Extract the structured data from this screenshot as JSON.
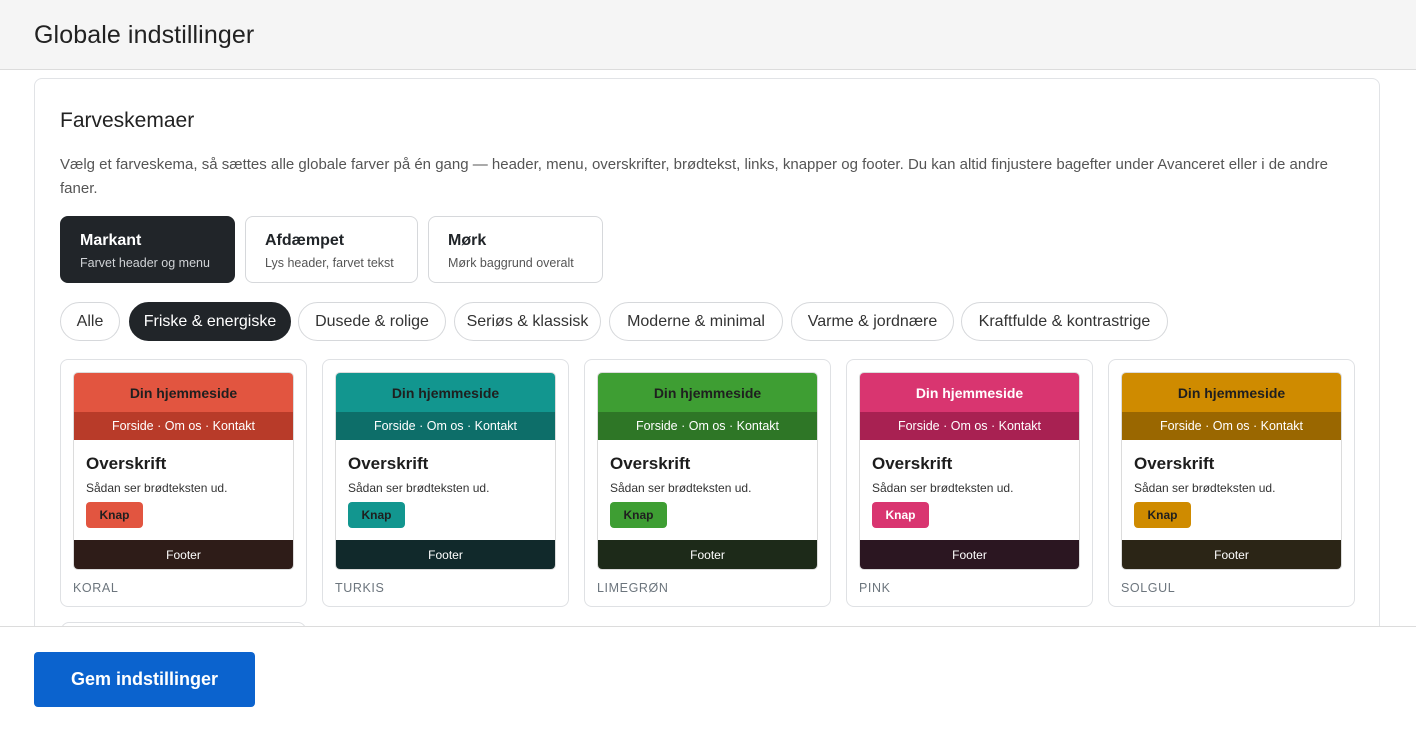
{
  "header": {
    "title": "Globale indstillinger"
  },
  "section": {
    "title": "Farveskemaer",
    "description": "Vælg et farveskema, så sættes alle globale farver på én gang — header, menu, overskrifter, brødtekst, links, knapper og footer. Du kan altid finjustere bagefter under Avanceret eller i de andre faner."
  },
  "modes": [
    {
      "title": "Markant",
      "subtitle": "Farvet header og menu",
      "active": true
    },
    {
      "title": "Afdæmpet",
      "subtitle": "Lys header, farvet tekst",
      "active": false
    },
    {
      "title": "Mørk",
      "subtitle": "Mørk baggrund overalt",
      "active": false
    }
  ],
  "filters": [
    {
      "label": "Alle",
      "active": false
    },
    {
      "label": "Friske & energiske",
      "active": true
    },
    {
      "label": "Dusede & rolige",
      "active": false
    },
    {
      "label": "Seriøs & klassisk",
      "active": false
    },
    {
      "label": "Moderne & minimal",
      "active": false
    },
    {
      "label": "Varme & jordnære",
      "active": false
    },
    {
      "label": "Kraftfulde & kontrastrige",
      "active": false
    }
  ],
  "preview": {
    "site_title": "Din hjemmeside",
    "nav": "Forside · Om os · Kontakt",
    "heading": "Overskrift",
    "body_text": "Sådan ser brødteksten ud.",
    "button": "Knap",
    "footer": "Footer"
  },
  "schemes": [
    {
      "name": "KORAL",
      "header_bg": "#e25540",
      "header_text": "#1f1f1f",
      "nav_bg": "#b83b29",
      "button_bg": "#e25540",
      "button_text": "#1f1f1f",
      "footer_bg": "#2e1c18"
    },
    {
      "name": "TURKIS",
      "header_bg": "#12968f",
      "header_text": "#1f1f1f",
      "nav_bg": "#0d6e69",
      "button_bg": "#12968f",
      "button_text": "#1f1f1f",
      "footer_bg": "#11292b"
    },
    {
      "name": "LIMEGRØN",
      "header_bg": "#3e9e33",
      "header_text": "#1f1f1f",
      "nav_bg": "#2e7626",
      "button_bg": "#3e9e33",
      "button_text": "#1f1f1f",
      "footer_bg": "#1d2a19"
    },
    {
      "name": "PINK",
      "header_bg": "#d93570",
      "header_text": "#ffffff",
      "nav_bg": "#a82152",
      "button_bg": "#d93570",
      "button_text": "#ffffff",
      "footer_bg": "#2b1621"
    },
    {
      "name": "SOLGUL",
      "header_bg": "#cf8b00",
      "header_text": "#1f1f1f",
      "nav_bg": "#9a6700",
      "button_bg": "#cf8b00",
      "button_text": "#1f1f1f",
      "footer_bg": "#2b2516"
    }
  ],
  "footer_bar": {
    "save_label": "Gem indstillinger"
  }
}
